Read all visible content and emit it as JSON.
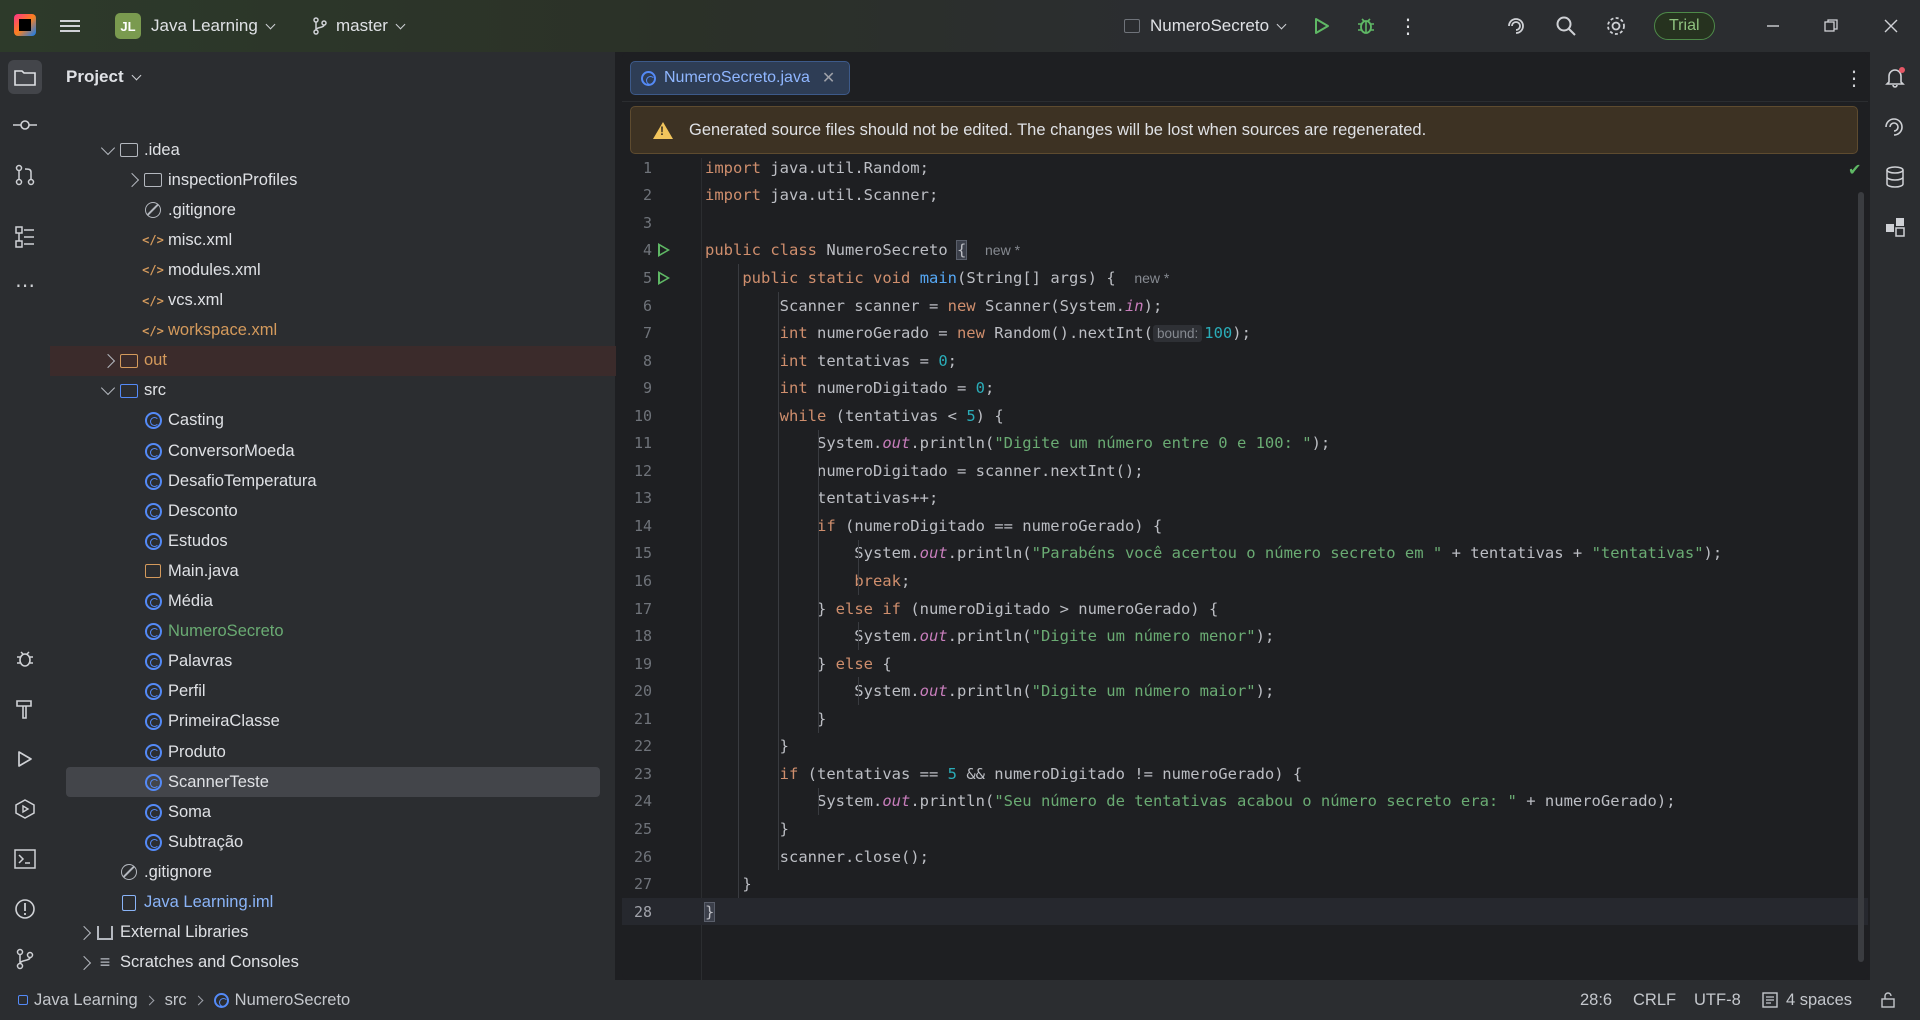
{
  "titlebar": {
    "project_initials": "JL",
    "project_name": "Java Learning",
    "branch": "master",
    "run_config": "NumeroSecreto",
    "trial_label": "Trial"
  },
  "project_panel": {
    "title": "Project",
    "tree": [
      {
        "label": ".idea",
        "icon": "folder-icon",
        "indent": 1,
        "arrow": "down"
      },
      {
        "label": "inspectionProfiles",
        "icon": "folder-icon",
        "indent": 2,
        "arrow": "right"
      },
      {
        "label": ".gitignore",
        "icon": "ignore-file-icon",
        "indent": 2,
        "arrow": ""
      },
      {
        "label": "misc.xml",
        "icon": "xml-file-icon",
        "indent": 2,
        "arrow": ""
      },
      {
        "label": "modules.xml",
        "icon": "xml-file-icon",
        "indent": 2,
        "arrow": ""
      },
      {
        "label": "vcs.xml",
        "icon": "xml-file-icon",
        "indent": 2,
        "arrow": ""
      },
      {
        "label": "workspace.xml",
        "icon": "xml-file-icon",
        "indent": 2,
        "arrow": "",
        "color": "#d49a5c"
      },
      {
        "label": "out",
        "icon": "folder-icon",
        "indent": 1,
        "arrow": "right",
        "color": "#d49a5c"
      },
      {
        "label": "src",
        "icon": "source-folder-icon",
        "indent": 1,
        "arrow": "down"
      },
      {
        "label": "Casting",
        "icon": "java-class-icon",
        "indent": 2,
        "arrow": ""
      },
      {
        "label": "ConversorMoeda",
        "icon": "java-class-icon",
        "indent": 2,
        "arrow": ""
      },
      {
        "label": "DesafioTemperatura",
        "icon": "java-class-icon",
        "indent": 2,
        "arrow": ""
      },
      {
        "label": "Desconto",
        "icon": "java-class-icon",
        "indent": 2,
        "arrow": ""
      },
      {
        "label": "Estudos",
        "icon": "java-class-icon",
        "indent": 2,
        "arrow": ""
      },
      {
        "label": "Main.java",
        "icon": "java-file-icon",
        "indent": 2,
        "arrow": ""
      },
      {
        "label": "Média",
        "icon": "java-class-icon",
        "indent": 2,
        "arrow": ""
      },
      {
        "label": "NumeroSecreto",
        "icon": "java-class-icon",
        "indent": 2,
        "arrow": "",
        "color": "#6aab73"
      },
      {
        "label": "Palavras",
        "icon": "java-class-icon",
        "indent": 2,
        "arrow": ""
      },
      {
        "label": "Perfil",
        "icon": "java-class-icon",
        "indent": 2,
        "arrow": ""
      },
      {
        "label": "PrimeiraClasse",
        "icon": "java-class-icon",
        "indent": 2,
        "arrow": ""
      },
      {
        "label": "Produto",
        "icon": "java-class-icon",
        "indent": 2,
        "arrow": ""
      },
      {
        "label": "ScannerTeste",
        "icon": "java-class-icon",
        "indent": 2,
        "arrow": "",
        "selected": true
      },
      {
        "label": "Soma",
        "icon": "java-class-icon",
        "indent": 2,
        "arrow": ""
      },
      {
        "label": "Subtração",
        "icon": "java-class-icon",
        "indent": 2,
        "arrow": ""
      },
      {
        "label": ".gitignore",
        "icon": "ignore-file-icon",
        "indent": 1,
        "arrow": ""
      },
      {
        "label": "Java Learning.iml",
        "icon": "iml-file-icon",
        "indent": 1,
        "arrow": "",
        "color": "#8ab4f8"
      },
      {
        "label": "External Libraries",
        "icon": "library-icon",
        "indent": 0,
        "arrow": "right"
      },
      {
        "label": "Scratches and Consoles",
        "icon": "scratches-icon",
        "indent": 0,
        "arrow": "right"
      }
    ]
  },
  "editor": {
    "tab_label": "NumeroSecreto.java",
    "banner": "Generated source files should not be edited. The changes will be lost when sources are regenerated.",
    "hint_new": "new *",
    "inlay_bound": "bound:",
    "lines": [
      "import java.util.Random;",
      "import java.util.Scanner;",
      "",
      "public class NumeroSecreto {",
      "    public static void main(String[] args) {",
      "        Scanner scanner = new Scanner(System.in);",
      "        int numeroGerado = new Random().nextInt(100);",
      "        int tentativas = 0;",
      "        int numeroDigitado = 0;",
      "        while (tentativas < 5) {",
      "            System.out.println(\"Digite um número entre 0 e 100: \");",
      "            numeroDigitado = scanner.nextInt();",
      "            tentativas++;",
      "            if (numeroDigitado == numeroGerado) {",
      "                System.out.println(\"Parabéns você acertou o número secreto em \" + tentativas + \"tentativas\");",
      "                break;",
      "            } else if (numeroDigitado > numeroGerado) {",
      "                System.out.println(\"Digite um número menor\");",
      "            } else {",
      "                System.out.println(\"Digite um número maior\");",
      "            }",
      "        }",
      "        if (tentativas == 5 && numeroDigitado != numeroGerado) {",
      "            System.out.println(\"Seu número de tentativas acabou o número secreto era: \" + numeroGerado);",
      "        }",
      "        scanner.close();",
      "    }",
      "}"
    ],
    "run_lines": [
      4,
      5
    ],
    "current_line": 28
  },
  "statusbar": {
    "crumbs": [
      "Java Learning",
      "src",
      "NumeroSecreto"
    ],
    "position": "28:6",
    "line_sep": "CRLF",
    "encoding": "UTF-8",
    "indent": "4 spaces"
  }
}
